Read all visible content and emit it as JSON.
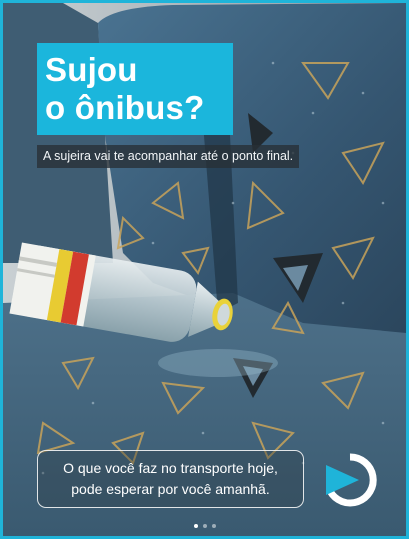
{
  "ad": {
    "headline_line1": "Sujou",
    "headline_line2": "o ônibus?",
    "subtitle": "A sujeira vai te acompanhar até o ponto final.",
    "cta_line1": "O que você faz no transporte hoje,",
    "cta_line2": "pode esperar por você amanhã.",
    "colors": {
      "frame": "#1fb4d9",
      "headline_bg": "#1bb6dc",
      "seat": "#3d5f79",
      "logo_triangle": "#1fb4d9"
    },
    "logo_icon": "circular-arrow-play-logo-icon"
  },
  "carousel": {
    "total_pages": 3,
    "active_page": 1
  }
}
